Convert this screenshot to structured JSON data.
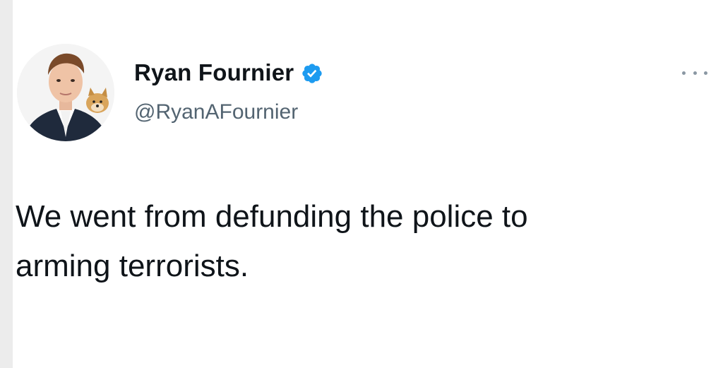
{
  "tweet": {
    "author": {
      "display_name": "Ryan Fournier",
      "handle": "@RyanAFournier",
      "verified": true,
      "avatar_icon": "user-avatar-photo"
    },
    "text": "We went from defunding the police to\narming terrorists.",
    "more_icon": "more-options-icon"
  },
  "colors": {
    "text_primary": "#0f1419",
    "text_secondary": "#536471",
    "verified_blue": "#1d9bf0",
    "background": "#ffffff"
  }
}
